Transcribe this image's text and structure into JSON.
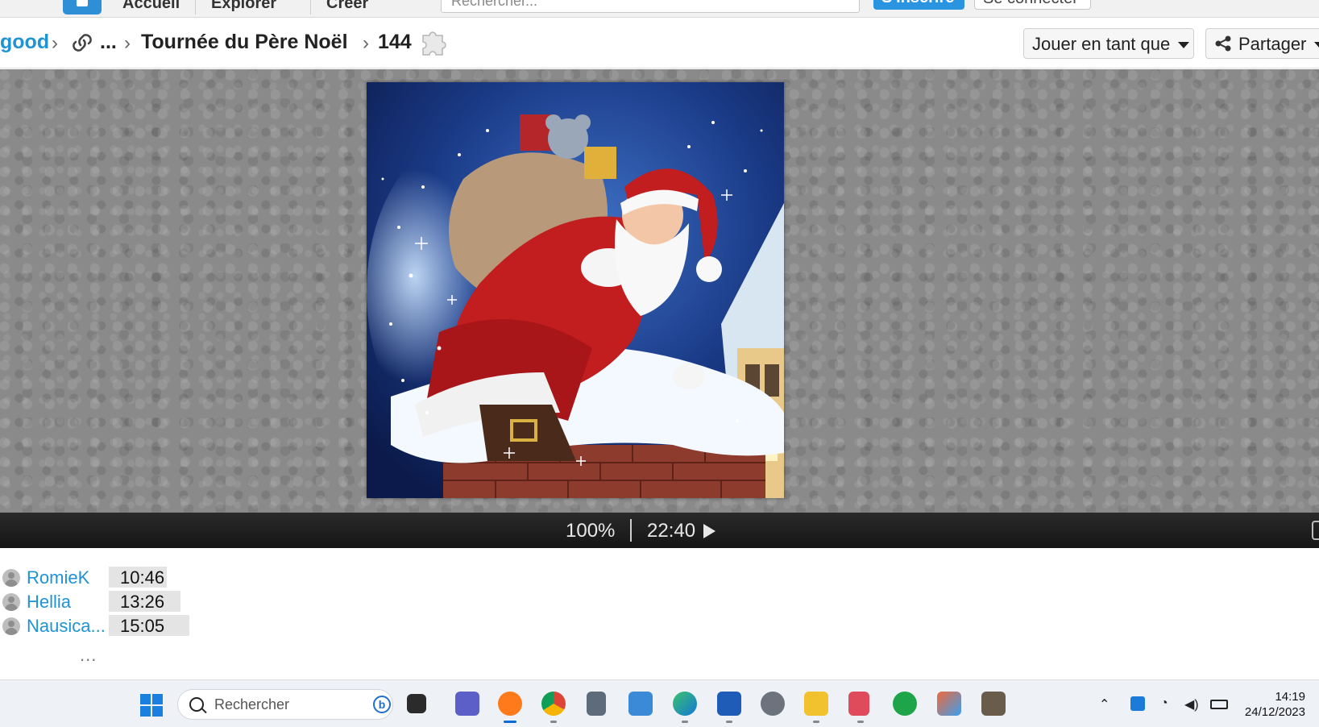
{
  "topnav": {
    "home": "home-icon",
    "links": [
      "Accueil",
      "Explorer",
      "Créer"
    ],
    "search_placeholder": "Rechercher...",
    "signup_label": "S'inscrire",
    "login_label": "Se connecter"
  },
  "breadcrumb": {
    "root": "good",
    "ellipsis": "...",
    "title": "Tournée du Père Noël",
    "pieces": "144"
  },
  "actions": {
    "play_as_label": "Jouer en tant que",
    "share_label": "Partager"
  },
  "puzzle": {
    "image_subject": "Santa Claus on a snowy chimney"
  },
  "controls": {
    "zoom": "100%",
    "time": "22:40"
  },
  "leaderboard": [
    {
      "name": "RomieK",
      "time": "10:46"
    },
    {
      "name": "Hellia",
      "time": "13:26"
    },
    {
      "name": "Nausica...",
      "time": "15:05"
    }
  ],
  "leaderboard_more": "...",
  "taskbar": {
    "search_placeholder": "Rechercher",
    "time": "14:19",
    "date": "24/12/2023"
  }
}
